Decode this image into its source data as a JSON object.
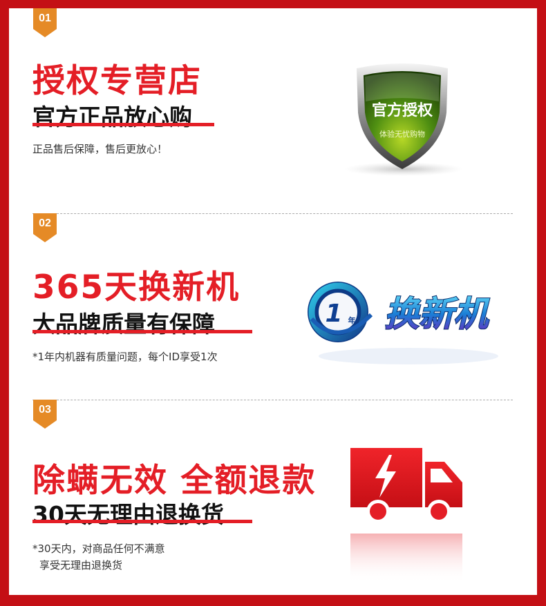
{
  "sections": [
    {
      "number": "01",
      "headline": "授权专营店",
      "subline": "官方正品放心购",
      "note": "正品售后保障，售后更放心！",
      "emblem": {
        "icon": "shield-icon",
        "title": "官方授权",
        "caption": "体验无忧购物"
      }
    },
    {
      "number": "02",
      "headline": "365天换新机",
      "subline": "大品牌质量有保障",
      "note": "*1年内机器有质量问题，每个ID享受1次",
      "emblem": {
        "icon": "replace-badge-icon",
        "number": "1",
        "unit": "年",
        "title": "换新机"
      }
    },
    {
      "number": "03",
      "headline": "除螨无效 全额退款",
      "subline": "30天无理由退换货",
      "note_lines": [
        "*30天内，对商品任何不满意",
        "享受无理由退换货"
      ],
      "emblem": {
        "icon": "delivery-truck-icon"
      }
    }
  ],
  "colors": {
    "accent": "#e41e26",
    "badge": "#e58a26",
    "frame": "#c40f15"
  }
}
